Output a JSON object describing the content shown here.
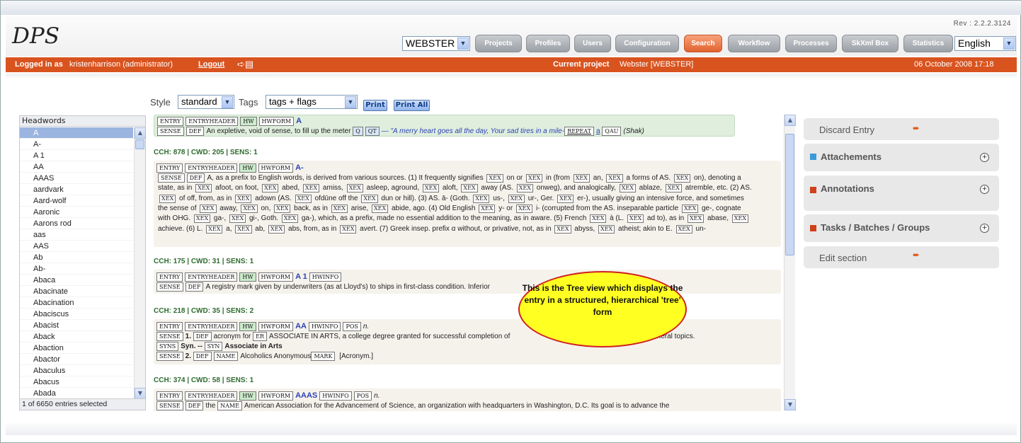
{
  "app": {
    "logo": "DPS",
    "rev": "Rev : 2.2.2.3124",
    "dictionary_select": "WEBSTER",
    "language_select": "English"
  },
  "nav": [
    "Projects",
    "Profiles",
    "Users",
    "Configuration",
    "Search",
    "Workflow",
    "Processes",
    "SkXml Box",
    "Statistics"
  ],
  "nav_active": "Search",
  "status": {
    "logged_in_prefix": "Logged in as",
    "user": "kristenharrison (administrator)",
    "logout": "Logout",
    "current_project_label": "Current project",
    "current_project": "Webster [WEBSTER]",
    "date": "06 October 2008 17:18"
  },
  "toolbar": {
    "style_label": "Style",
    "style_value": "standard",
    "tags_label": "Tags",
    "tags_value": "tags + flags",
    "print": "Print",
    "print_all": "Print All"
  },
  "headwords": {
    "title": "Headwords",
    "items": [
      "A",
      "A-",
      "A 1",
      "AA",
      "AAAS",
      "aardvark",
      "Aard-wolf",
      "Aaronic",
      "Aarons rod",
      "aas",
      "AAS",
      "Ab",
      "Ab-",
      "Abaca",
      "Abacinate",
      "Abacination",
      "Abaciscus",
      "Abacist",
      "Aback",
      "Abaction",
      "Abactor",
      "Abaculus",
      "Abacus",
      "Abada"
    ],
    "selected": "A",
    "footer": "1 of 6650 entries selected"
  },
  "tree": {
    "top": {
      "hw": "A",
      "def": "An expletive, void of sense, to fill up the meter",
      "q": "Q",
      "qt": "QT",
      "quote": "— \"A merry heart goes all the day, Your sad tires in a mile-",
      "repeat": "REPEAT",
      "a": "a",
      "qau": "QAU",
      "shak": "(Shak)"
    },
    "e1": {
      "meta": "CCH: 878  |  CWD: 205  |  SENS: 1",
      "hw": "A-",
      "text": "A, as a prefix to English words, is derived from various sources. (1) It frequently signifies XEX on or XEX in (from XEX an, XEX a forms of AS. XEX on), denoting a state, as in XEX afoot, on foot, XEX abed, XEX amiss, XEX asleep, aground, XEX aloft, XEX away (AS. XEX onweg), and analogically, XEX ablaze, XEX atremble, etc. (2) AS. XEX of off, from, as in XEX adown (AS. XEX ofdūne off the XEX dun or hill). (3) AS. ā- (Goth. XEX us-, XEX ur-, Ger. XEX er-), usually giving an intensive force, and sometimes the sense of XEX away, XEX on, XEX back, as in XEX arise, XEX abide, ago. (4) Old English XEX y- or XEX i- (corrupted from the AS. inseparable particle XEX ge-, cognate with OHG. XEX ga-, XEX gi-, Goth. XEX ga-), which, as a prefix, made no essential addition to the meaning, as in aware. (5) French XEX à (L. XEX ad to), as in XEX abase, XEX achieve. (6) L. XEX a, XEX ab, XEX abs, from, as in XEX avert. (7) Greek insep. prefix α without, or privative, not, as in XEX abyss, XEX atheist; akin to E. XEX un-"
    },
    "e2": {
      "meta": "CCH: 175  |  CWD: 31  |  SENS: 1",
      "hw": "A 1",
      "def": "A registry mark given by underwriters (as at Lloyd's) to ships in first-class condition. Inferior"
    },
    "e3": {
      "meta": "CCH: 218  |  CWD: 35  |  SENS: 2",
      "hw": "AA",
      "pos": "n.",
      "def1": "acronym for",
      "def1b": "ASSOCIATE IN ARTS, a college degree granted for successful completion of",
      "def1c": "arts or general topics.",
      "syn_label": "Syn. --",
      "syn": "Associate in Arts",
      "def2": "Alcoholics Anonymous",
      "def2b": "[Acronym.]"
    },
    "e4": {
      "meta": "CCH: 374  |  CWD: 58  |  SENS: 1",
      "hw": "AAAS",
      "pos": "n.",
      "the": "the",
      "def": "American Association for the Advancement of Science, an organization with headquarters in Washington, D.C. Its goal is to advance the"
    }
  },
  "right": {
    "discard": "Discard Entry",
    "attachements": "Attachements",
    "annotations": "Annotations",
    "tasks": "Tasks / Batches / Groups",
    "edit": "Edit section"
  },
  "callout": "This is the Tree view which displays the entry in a structured, hierarchical 'tree' form",
  "colors": {
    "accent": "#d9531f",
    "active_nav": "#e2622e"
  }
}
